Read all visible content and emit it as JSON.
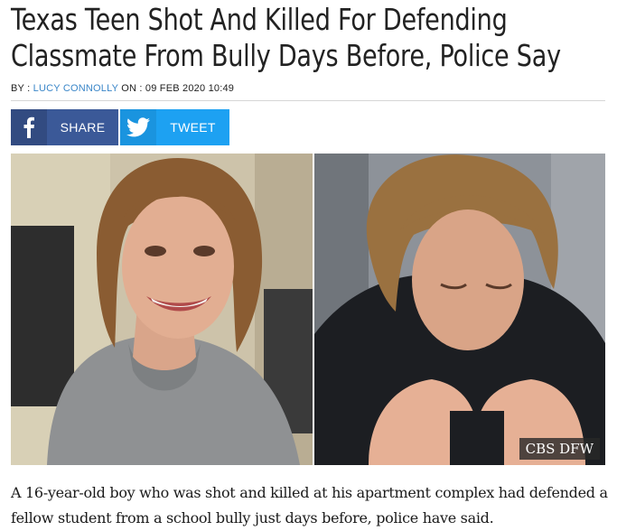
{
  "article": {
    "headline": "Texas Teen Shot And Killed For Defending Classmate From Bully Days Before, Police Say",
    "byline_prefix": "BY : ",
    "author": "LUCY CONNOLLY",
    "date_prefix": " ON : ",
    "date": "09 FEB 2020 10:49",
    "lede": "A 16-year-old boy who was shot and killed at his apartment complex had defended a fellow student from a school bully just days before, police have said."
  },
  "share": {
    "facebook_label": "SHARE",
    "facebook_icon": "facebook-icon",
    "twitter_label": "TWEET",
    "twitter_icon": "twitter-icon"
  },
  "image": {
    "credit": "CBS DFW"
  },
  "colors": {
    "facebook": "#3b5998",
    "twitter": "#1da1f2",
    "author_link": "#3a86c8"
  }
}
